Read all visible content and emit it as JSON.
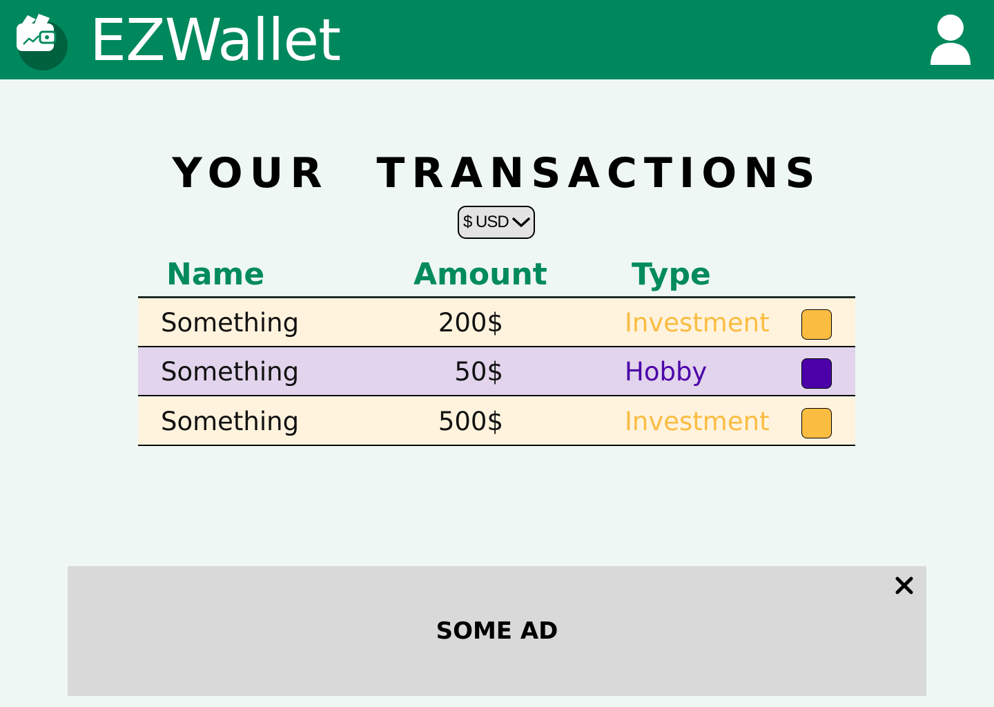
{
  "header": {
    "app_title": "EZWallet",
    "brand_color": "#00885d",
    "logo_icon": "wallet-icon",
    "profile_icon": "user-icon"
  },
  "main": {
    "title": "YOUR TRANSACTIONS",
    "currency_selector": {
      "value": "$ USD",
      "icon": "chevron-down-icon"
    },
    "table": {
      "columns": [
        "Name",
        "Amount",
        "Type"
      ],
      "rows": [
        {
          "name": "Something",
          "amount": "200$",
          "type": "Investment",
          "type_color": "#fbbc42",
          "row_color": "#fff3dd"
        },
        {
          "name": "Something",
          "amount": "50$",
          "type": "Hobby",
          "type_color": "#4b00a8",
          "row_color": "#e1d4ec"
        },
        {
          "name": "Something",
          "amount": "500$",
          "type": "Investment",
          "type_color": "#fbbc42",
          "row_color": "#fff3dd"
        }
      ]
    }
  },
  "ad": {
    "text": "SOME AD",
    "close_icon": "close-icon"
  }
}
